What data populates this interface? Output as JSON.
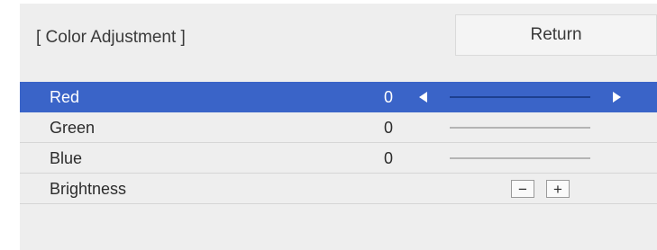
{
  "header": {
    "title": "[ Color Adjustment ]",
    "return_label": "Return"
  },
  "rows": [
    {
      "label": "Red",
      "value": "0",
      "selected": true
    },
    {
      "label": "Green",
      "value": "0",
      "selected": false
    },
    {
      "label": "Blue",
      "value": "0",
      "selected": false
    },
    {
      "label": "Brightness",
      "minus_label": "−",
      "plus_label": "+"
    }
  ],
  "colors": {
    "selected_row": "#3a64c8",
    "panel_background": "#eeeeee"
  }
}
